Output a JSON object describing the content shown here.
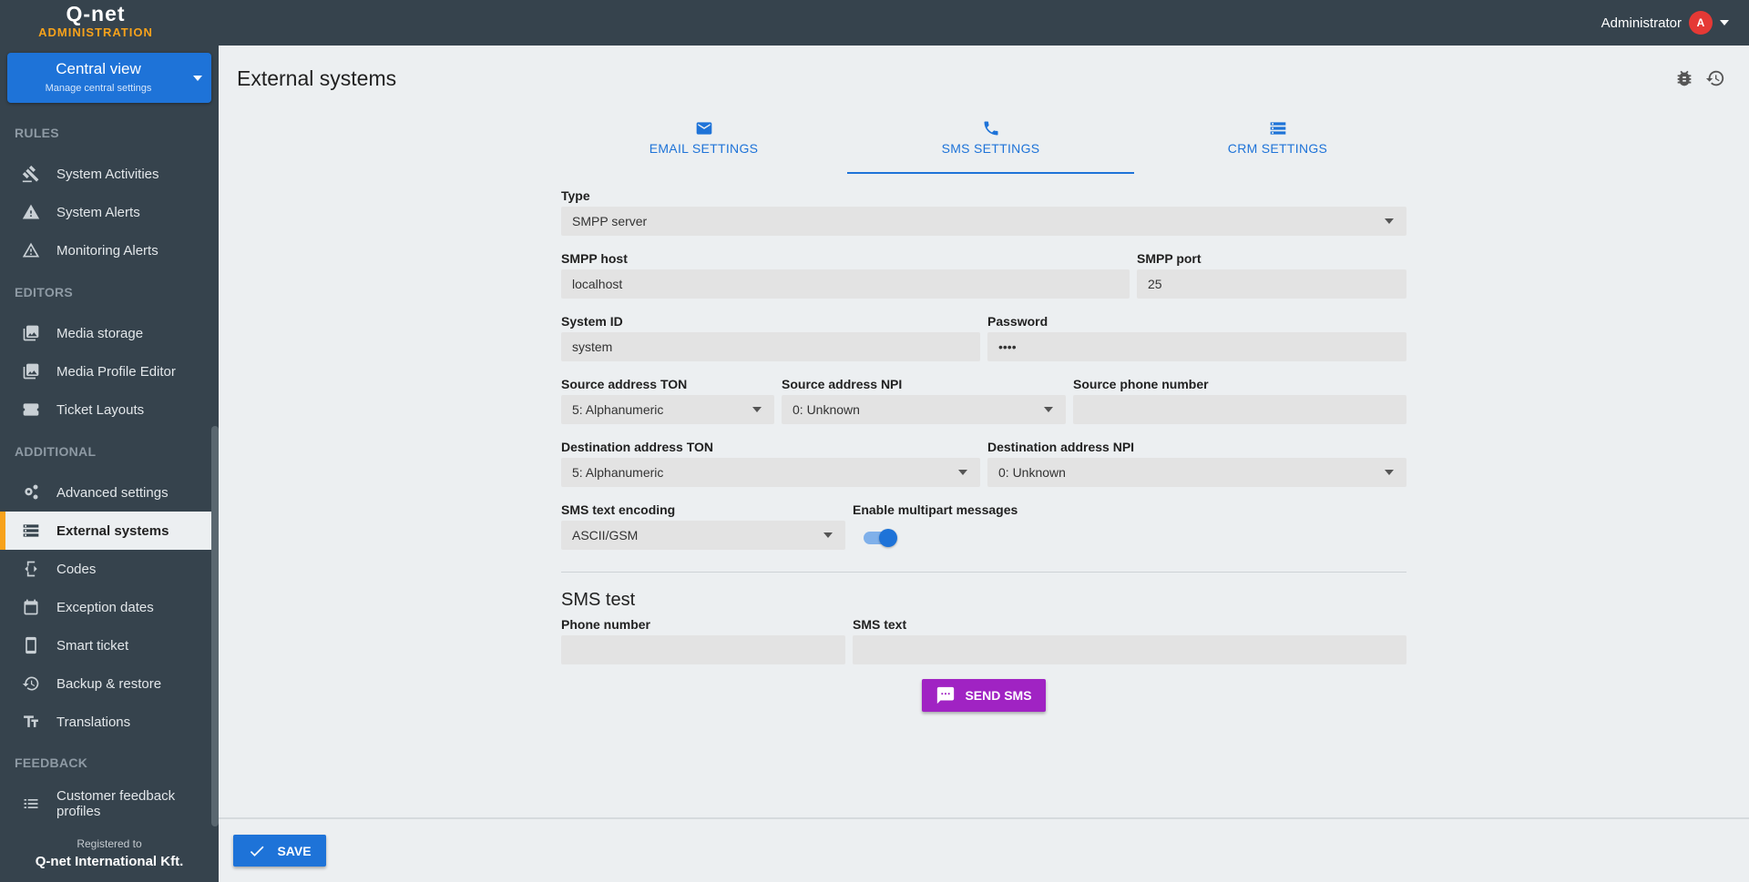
{
  "header": {
    "logo_top": "Q-net",
    "logo_bottom": "ADMINISTRATION",
    "user_name": "Administrator",
    "avatar_letter": "A"
  },
  "sidebar": {
    "central": {
      "title": "Central view",
      "subtitle": "Manage central settings"
    },
    "sections": {
      "rules": "RULES",
      "editors": "EDITORS",
      "additional": "ADDITIONAL",
      "feedback": "FEEDBACK"
    },
    "items": {
      "system_activities": "System Activities",
      "system_alerts": "System Alerts",
      "monitoring_alerts": "Monitoring Alerts",
      "media_storage": "Media storage",
      "media_profile_editor": "Media Profile Editor",
      "ticket_layouts": "Ticket Layouts",
      "advanced_settings": "Advanced settings",
      "external_systems": "External systems",
      "codes": "Codes",
      "exception_dates": "Exception dates",
      "smart_ticket": "Smart ticket",
      "backup_restore": "Backup & restore",
      "translations": "Translations",
      "customer_feedback_1": "Customer feedback",
      "customer_feedback_2": "profiles"
    },
    "registered_label": "Registered to",
    "registered_name": "Q-net International Kft."
  },
  "page": {
    "title": "External systems",
    "tabs": {
      "email": "EMAIL SETTINGS",
      "sms": "SMS SETTINGS",
      "crm": "CRM SETTINGS"
    }
  },
  "form": {
    "type_label": "Type",
    "type_value": "SMPP server",
    "host_label": "SMPP host",
    "host_value": "localhost",
    "port_label": "SMPP port",
    "port_value": "25",
    "sysid_label": "System ID",
    "sysid_value": "system",
    "password_label": "Password",
    "password_value": "••••",
    "src_ton_label": "Source address TON",
    "src_ton_value": "5: Alphanumeric",
    "src_npi_label": "Source address NPI",
    "src_npi_value": "0: Unknown",
    "src_phone_label": "Source phone number",
    "src_phone_value": "",
    "dst_ton_label": "Destination address TON",
    "dst_ton_value": "5: Alphanumeric",
    "dst_npi_label": "Destination address NPI",
    "dst_npi_value": "0: Unknown",
    "encoding_label": "SMS text encoding",
    "encoding_value": "ASCII/GSM",
    "multipart_label": "Enable multipart messages",
    "multipart_enabled": true
  },
  "sms_test": {
    "heading": "SMS test",
    "phone_label": "Phone number",
    "phone_value": "",
    "text_label": "SMS text",
    "text_value": "",
    "send_label": "SEND SMS"
  },
  "footer": {
    "save_label": "SAVE"
  },
  "colors": {
    "accent": "#1e73d8",
    "sidebar": "#36434d",
    "brand_orange": "#f7a21b",
    "send_button": "#a023c3"
  }
}
